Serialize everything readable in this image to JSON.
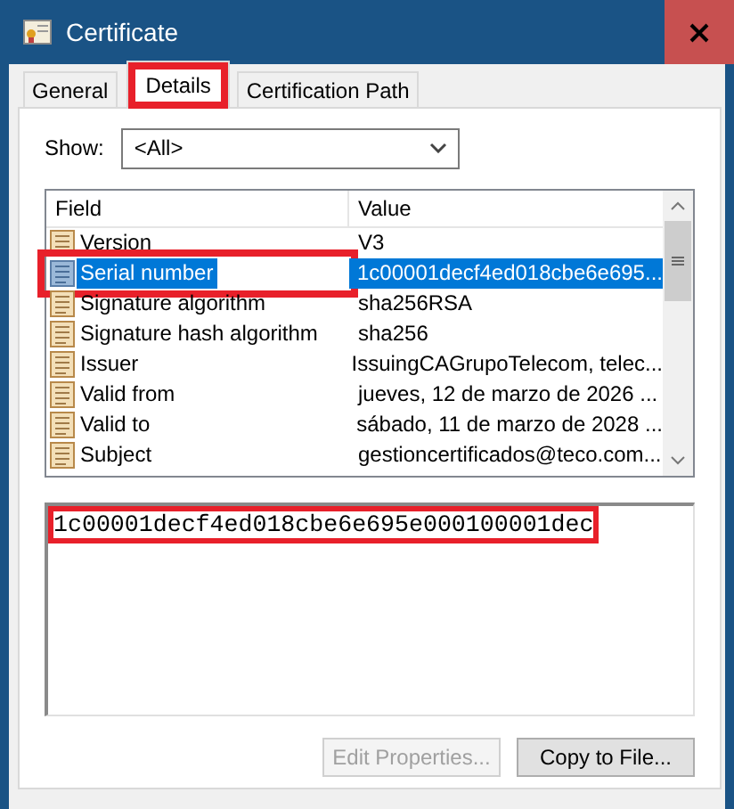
{
  "window": {
    "title": "Certificate"
  },
  "tabs": [
    {
      "label": "General",
      "selected": false,
      "highlighted": false
    },
    {
      "label": "Details",
      "selected": true,
      "highlighted": true
    },
    {
      "label": "Certification Path",
      "selected": false,
      "highlighted": false
    }
  ],
  "show": {
    "label": "Show:",
    "value": "<All>"
  },
  "list": {
    "columns": [
      "Field",
      "Value"
    ],
    "rows": [
      {
        "field": "Version",
        "value": "V3",
        "selected": false,
        "highlighted": false
      },
      {
        "field": "Serial number",
        "value": "1c00001decf4ed018cbe6e695...",
        "selected": true,
        "highlighted": true
      },
      {
        "field": "Signature algorithm",
        "value": "sha256RSA",
        "selected": false,
        "highlighted": false
      },
      {
        "field": "Signature hash algorithm",
        "value": "sha256",
        "selected": false,
        "highlighted": false
      },
      {
        "field": "Issuer",
        "value": "IssuingCAGrupoTelecom, telec...",
        "selected": false,
        "highlighted": false
      },
      {
        "field": "Valid from",
        "value": "jueves, 12 de marzo de 2026 ...",
        "selected": false,
        "highlighted": false
      },
      {
        "field": "Valid to",
        "value": "sábado, 11 de marzo de 2028 ...",
        "selected": false,
        "highlighted": false
      },
      {
        "field": "Subject",
        "value": "gestioncertificados@teco.com...",
        "selected": false,
        "highlighted": false
      }
    ]
  },
  "detail": {
    "text": "1c00001decf4ed018cbe6e695e000100001dec",
    "highlighted": true
  },
  "buttons": [
    {
      "label": "Edit Properties...",
      "disabled": true
    },
    {
      "label": "Copy to File...",
      "disabled": false
    }
  ]
}
